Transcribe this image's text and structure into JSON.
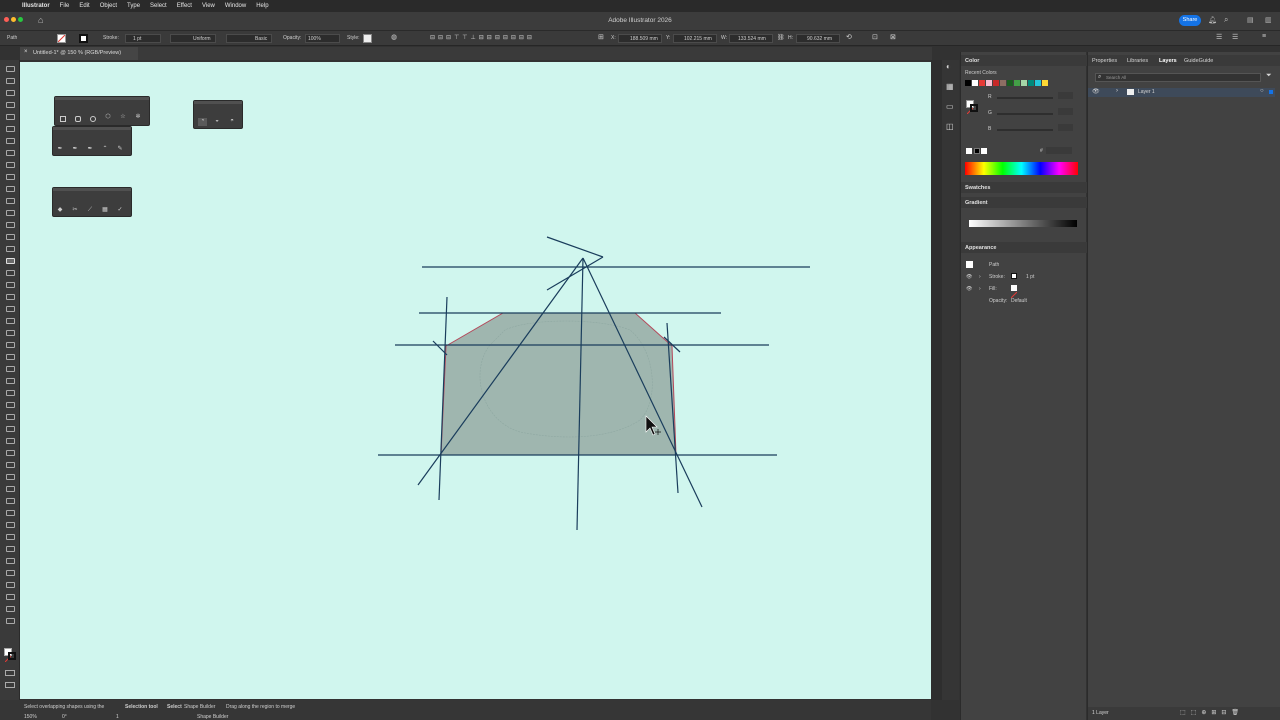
{
  "menubar": {
    "app": "Illustrator",
    "items": [
      "File",
      "Edit",
      "Object",
      "Type",
      "Select",
      "Effect",
      "View",
      "Window",
      "Help"
    ]
  },
  "window": {
    "title": "Adobe Illustrator 2026",
    "share_label": "Share"
  },
  "controlbar": {
    "selection_type": "Path",
    "stroke_label": "Stroke:",
    "stroke_weight": "1 pt",
    "profile": "Uniform",
    "brush": "Basic",
    "opacity_label": "Opacity:",
    "opacity_value": "100%",
    "style_label": "Style:",
    "x_label": "X:",
    "x_value": "188.509 mm",
    "y_label": "Y:",
    "y_value": "102.215 mm",
    "w_label": "W:",
    "w_value": "133.524 mm",
    "h_label": "H:",
    "h_value": "90.632 mm"
  },
  "document": {
    "tab_title": "Untitled-1* @ 150 % (RGB/Preview)"
  },
  "color_panel": {
    "tab": "Color",
    "recent_colors_label": "Recent Colors",
    "channels": [
      "R",
      "G",
      "B"
    ],
    "hex_symbol": "#",
    "recent_colors": [
      "#000000",
      "#ffffff",
      "#e53935",
      "#f8bbd0",
      "#c62828",
      "#8d6e63",
      "#1b5e20",
      "#43a047",
      "#a5d6a7",
      "#00897b",
      "#26c6da",
      "#fdd835"
    ]
  },
  "swatches_panel": {
    "tab": "Swatches"
  },
  "gradient_panel": {
    "tab": "Gradient"
  },
  "appearance_panel": {
    "tab": "Appearance",
    "object": "Path",
    "stroke_label": "Stroke:",
    "stroke_value": "1 pt",
    "fill_label": "Fill:",
    "opacity_label": "Opacity:",
    "opacity_value": "Default"
  },
  "layers_panel": {
    "tabs": [
      "Properties",
      "Libraries",
      "Layers",
      "GuideGuide"
    ],
    "active_tab": "Layers",
    "search_placeholder": "Search All",
    "layers": [
      "Layer 1"
    ],
    "footer_count": "1 Layer"
  },
  "statusbar": {
    "zoom": "150%",
    "rotation": "0°",
    "artboard": "1",
    "tool_name": "Shape Builder",
    "hint_1": "Select overlapping shapes using the",
    "hint_1_tool": "Selection tool",
    "hint_2_prefix": "Select",
    "hint_2_tool": "Shape Builder",
    "hint_3": "Drag along the region to merge"
  },
  "colors": {
    "canvas_bg": "#d0f6ee",
    "shape_fill": "#9fb6af",
    "shape_stroke": "#b5485a",
    "guide_lines": "#1a3d5c",
    "selection_accent": "#1473e6"
  }
}
